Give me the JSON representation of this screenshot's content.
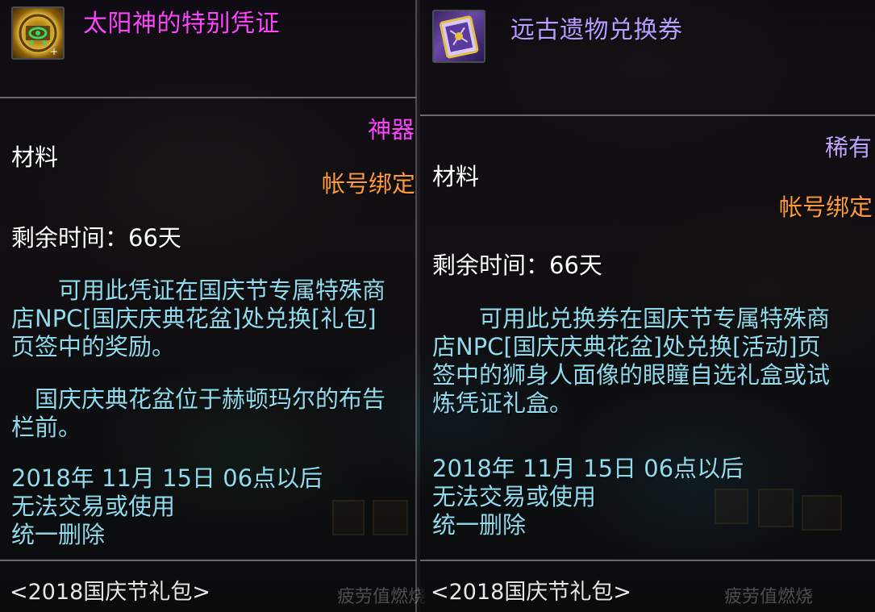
{
  "left": {
    "name": "太阳神的特别凭证",
    "rarity": "神器",
    "type": "材料",
    "binding": "帐号绑定",
    "remaining_time": "剩余时间：66天",
    "desc_para1": "　　可用此凭证在国庆节专属特殊商店NPC[国庆庆典花盆]处兑换[礼包]页签中的奖励。",
    "desc_para2": "　国庆庆典花盆位于赫顿玛尔的布告栏前。",
    "expiry_line1": "2018年 11月 15日 06点以后",
    "expiry_line2": "无法交易或使用",
    "expiry_line3": "统一删除",
    "source": "<2018国庆节礼包>",
    "bg_text": "疲劳值燃烧"
  },
  "right": {
    "name": "远古遗物兑换券",
    "rarity": "稀有",
    "type": "材料",
    "binding": "帐号绑定",
    "remaining_time": "剩余时间：66天",
    "desc_para1": "　　可用此兑换券在国庆节专属特殊商店NPC[国庆庆典花盆]处兑换[活动]页签中的狮身人面像的眼瞳自选礼盒或试炼凭证礼盒。",
    "expiry_line1": "2018年 11月 15日 06点以后",
    "expiry_line2": "无法交易或使用",
    "expiry_line3": "统一删除",
    "source": "<2018国庆节礼包>",
    "bg_text": "疲劳值燃烧"
  },
  "colors": {
    "artifact": "#ff44ff",
    "rare": "#b89cff",
    "binding": "#ff9a3a",
    "description": "#8fdcee"
  },
  "icons": {
    "left_item": "sun-token-icon",
    "right_item": "relic-voucher-icon"
  }
}
